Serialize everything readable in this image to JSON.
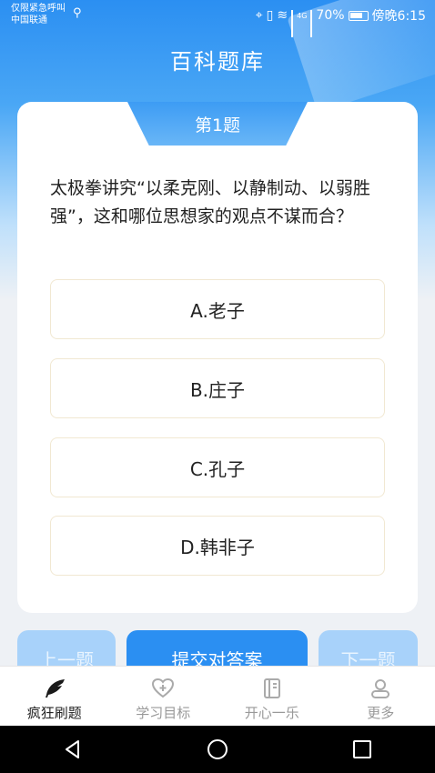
{
  "status_bar": {
    "carrier_line1": "仅限紧急呼叫",
    "carrier_line2": "中国联通",
    "battery": "70%",
    "time": "傍晚6:15",
    "network": "4G"
  },
  "header": {
    "title": "百科题库"
  },
  "question": {
    "number_label": "第1题",
    "text": "太极拳讲究“以柔克刚、以静制动、以弱胜强”，这和哪位思想家的观点不谋而合？",
    "options": [
      {
        "label": "A.老子"
      },
      {
        "label": "B.庄子"
      },
      {
        "label": "C.孔子"
      },
      {
        "label": "D.韩非子"
      }
    ]
  },
  "actions": {
    "prev_label": "上一题",
    "submit_label": "提交对答案",
    "next_label": "下一题"
  },
  "tabbar": {
    "items": [
      {
        "label": "疯狂刷题",
        "icon": "feather-icon",
        "active": true
      },
      {
        "label": "学习目标",
        "icon": "heart-plus-icon",
        "active": false
      },
      {
        "label": "开心一乐",
        "icon": "notebook-icon",
        "active": false
      },
      {
        "label": "更多",
        "icon": "person-icon",
        "active": false
      }
    ]
  },
  "colors": {
    "accent": "#2b8ff2",
    "accent_light": "#a8d2fa",
    "option_border": "#f1e8d2"
  }
}
